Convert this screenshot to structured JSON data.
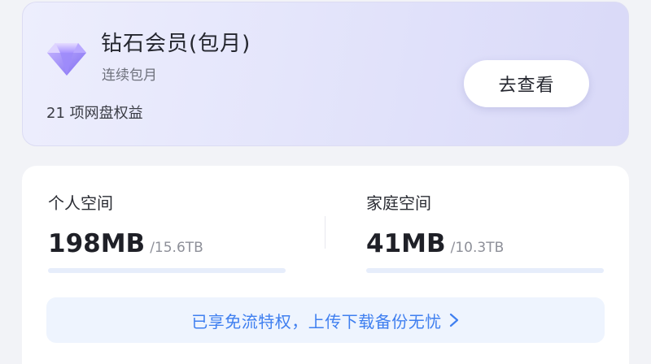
{
  "membership": {
    "title": "钻石会员(包月)",
    "subtitle": "连续包月",
    "benefits": "21 项网盘权益",
    "button_label": "去查看",
    "icon": "diamond-icon"
  },
  "storage": {
    "personal": {
      "label": "个人空间",
      "used": "198MB",
      "total": "/15.6TB",
      "usage_fraction": 0.0
    },
    "family": {
      "label": "家庭空间",
      "used": "41MB",
      "total": "/10.3TB",
      "usage_fraction": 0.0
    }
  },
  "promo": {
    "text": "已享免流特权，上传下载备份无忧",
    "icon": "chevron-right-icon"
  },
  "colors": {
    "accent": "#3f7ff0",
    "bar_track": "#e6edfb",
    "bar_fill": "#3b7cf5",
    "card_gradient_start": "#edeefd",
    "card_gradient_end": "#d9d9f8"
  }
}
